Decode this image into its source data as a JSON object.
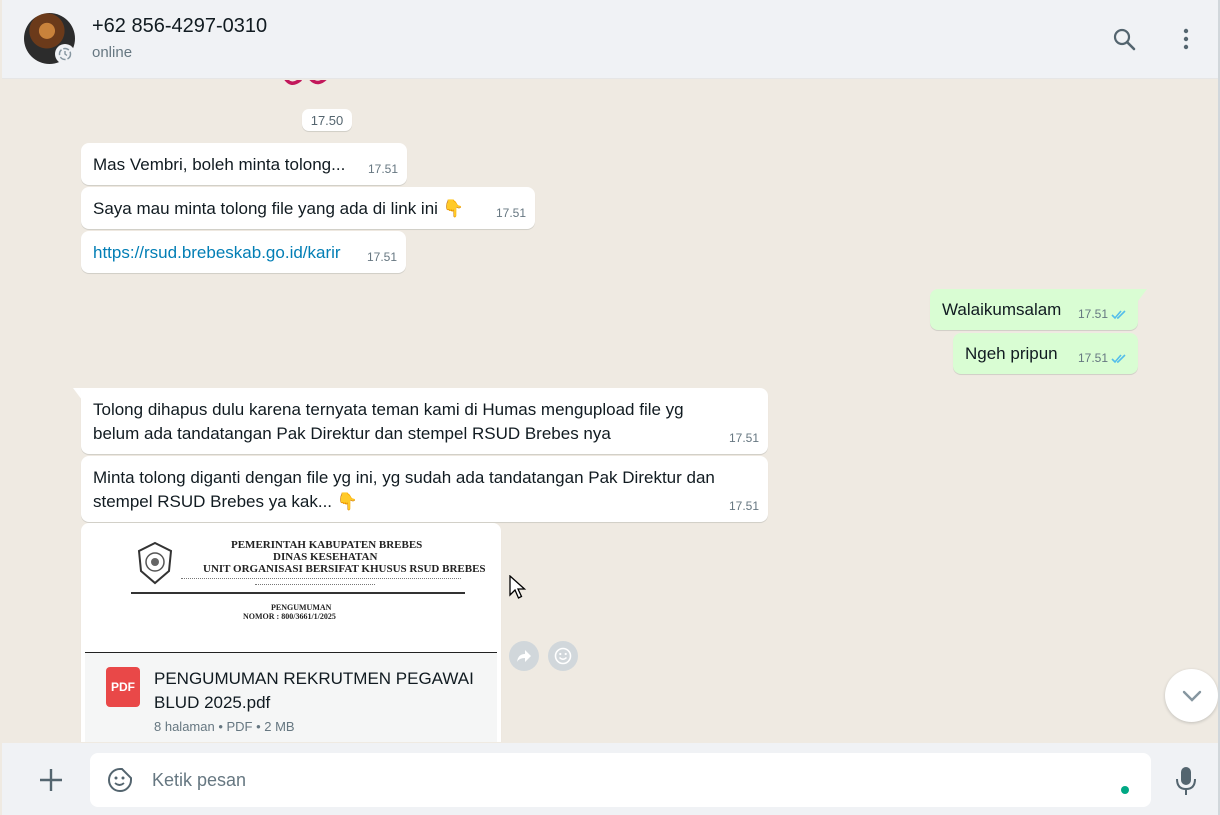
{
  "header": {
    "contact_name": "+62 856-4297-0310",
    "status": "online",
    "icons": [
      "search-icon",
      "more-vertical-icon"
    ]
  },
  "chat": {
    "date_pill": "17.50",
    "messages": [
      {
        "direction": "in",
        "text": "Mas Vembri, boleh minta tolong...",
        "time": "17.51"
      },
      {
        "direction": "in",
        "text": "Saya mau minta tolong file yang ada di link ini 👇",
        "time": "17.51"
      },
      {
        "direction": "in",
        "text": "https://rsud.brebeskab.go.id/karir",
        "time": "17.51",
        "is_link": true
      },
      {
        "direction": "out",
        "text": "Walaikumsalam",
        "time": "17.51",
        "read": true
      },
      {
        "direction": "out",
        "text": "Ngeh pripun",
        "time": "17.51",
        "read": true
      },
      {
        "direction": "in",
        "text": "Tolong dihapus dulu karena ternyata teman kami di Humas mengupload file yg belum ada tandatangan Pak Direktur dan stempel RSUD Brebes nya",
        "time": "17.51"
      },
      {
        "direction": "in",
        "text": "Minta tolong diganti dengan file yg ini, yg sudah ada tandatangan Pak Direktur dan stempel RSUD Brebes ya kak... 👇",
        "time": "17.51"
      }
    ],
    "document": {
      "preview_lines": [
        "PEMERINTAH  KABUPATEN BREBES",
        "DINAS KESEHATAN",
        "UNIT ORGANISASI BERSIFAT KHUSUS RSUD BREBES",
        "PENGUMUMAN",
        "NOMOR : 800/3661/1/2025"
      ],
      "icon_label": "PDF",
      "file_name": "PENGUMUMAN REKRUTMEN PEGAWAI BLUD 2025.pdf",
      "meta": "8 halaman • PDF • 2 MB"
    }
  },
  "footer": {
    "placeholder": "Ketik pesan"
  },
  "colors": {
    "chat_bg": "#efeae2",
    "outgoing_bubble": "#d9fdd3",
    "incoming_bubble": "#ffffff",
    "link": "#027eb5",
    "read_ticks": "#53bdeb",
    "accent": "#00a884"
  }
}
